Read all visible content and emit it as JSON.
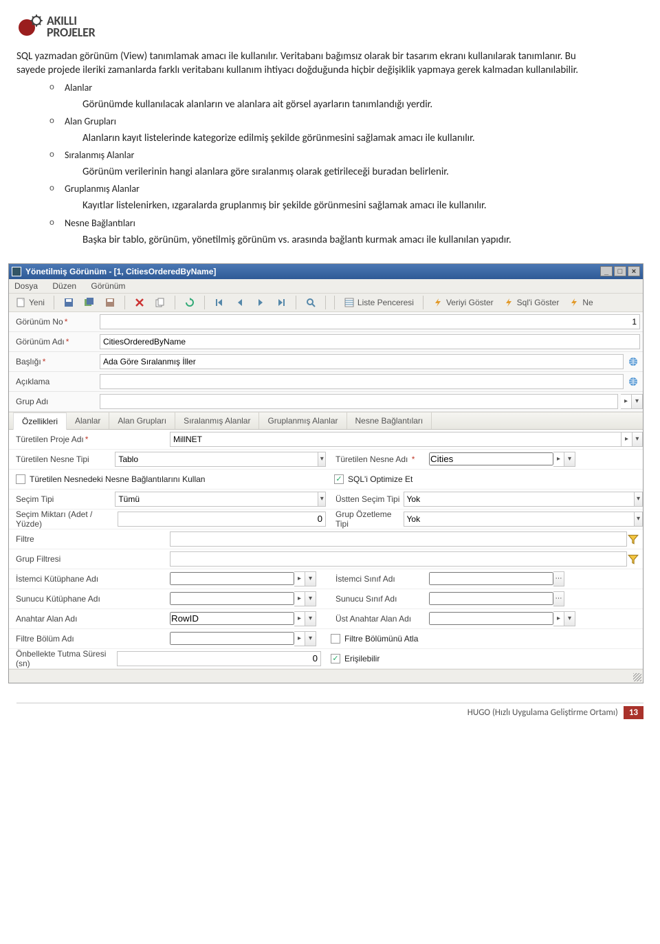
{
  "logo": {
    "line1": "AKILLI",
    "line2": "PROJELER"
  },
  "intro": {
    "p1": "SQL yazmadan görünüm (View) tanımlamak amacı ile kullanılır. Veritabanı bağımsız olarak bir tasarım ekranı kullanılarak tanımlanır. Bu sayede projede ileriki zamanlarda farklı veritabanı kullanım ihtiyacı doğduğunda hiçbir değişiklik yapmaya gerek kalmadan kullanılabilir."
  },
  "bullets": [
    {
      "label": "Alanlar",
      "desc": "Görünümde kullanılacak alanların ve alanlara ait görsel ayarların tanımlandığı yerdir."
    },
    {
      "label": "Alan Grupları",
      "desc": "Alanların kayıt listelerinde kategorize edilmiş şekilde görünmesini sağlamak amacı ile kullanılır."
    },
    {
      "label": "Sıralanmış Alanlar",
      "desc": "Görünüm verilerinin hangi alanlara göre sıralanmış olarak getirileceği buradan belirlenir."
    },
    {
      "label": "Gruplanmış Alanlar",
      "desc": "Kayıtlar listelenirken, ızgaralarda gruplanmış bir şekilde görünmesini sağlamak amacı ile kullanılır."
    },
    {
      "label": "Nesne Bağlantıları",
      "desc": "Başka bir tablo, görünüm, yönetilmiş görünüm vs. arasında bağlantı kurmak amacı ile kullanılan yapıdır."
    }
  ],
  "window": {
    "title": "Yönetilmiş Görünüm - [1, CitiesOrderedByName]",
    "menu": [
      "Dosya",
      "Düzen",
      "Görünüm"
    ],
    "toolbar": {
      "yeni": "Yeni",
      "liste": "Liste Penceresi",
      "veriyi": "Veriyi Göster",
      "sqli": "Sql'i Göster",
      "ne": "Ne"
    },
    "form": {
      "gorunum_no_lbl": "Görünüm No",
      "gorunum_no_val": "1",
      "gorunum_adi_lbl": "Görünüm Adı",
      "gorunum_adi_val": "CitiesOrderedByName",
      "basligi_lbl": "Başlığı",
      "basligi_val": "Ada Göre Sıralanmış İller",
      "aciklama_lbl": "Açıklama",
      "aciklama_val": "",
      "grup_adi_lbl": "Grup Adı",
      "grup_adi_val": ""
    },
    "tabs": [
      "Özellikleri",
      "Alanlar",
      "Alan Grupları",
      "Sıralanmış Alanlar",
      "Gruplanmış Alanlar",
      "Nesne Bağlantıları"
    ],
    "props": {
      "turetilen_proje_adi_lbl": "Türetilen Proje Adı",
      "turetilen_proje_adi_val": "MillNET",
      "turetilen_nesne_tipi_lbl": "Türetilen Nesne Tipi",
      "turetilen_nesne_tipi_val": "Tablo",
      "turetilen_nesne_adi_lbl": "Türetilen Nesne Adı",
      "turetilen_nesne_adi_val": "Cities",
      "kullan_lbl": "Türetilen Nesnedeki Nesne Bağlantılarını Kullan",
      "sql_opt_lbl": "SQL'i Optimize Et",
      "secim_tipi_lbl": "Seçim Tipi",
      "secim_tipi_val": "Tümü",
      "ustten_secim_lbl": "Üstten Seçim Tipi",
      "ustten_secim_val": "Yok",
      "secim_miktari_lbl": "Seçim Miktarı (Adet / Yüzde)",
      "secim_miktari_val": "0",
      "grup_ozet_lbl": "Grup Özetleme Tipi",
      "grup_ozet_val": "Yok",
      "filtre_lbl": "Filtre",
      "grup_filtre_lbl": "Grup Filtresi",
      "istemci_kutuphane_lbl": "İstemci Kütüphane Adı",
      "istemci_sinif_lbl": "İstemci Sınıf Adı",
      "sunucu_kutuphane_lbl": "Sunucu Kütüphane Adı",
      "sunucu_sinif_lbl": "Sunucu Sınıf Adı",
      "anahtar_alan_lbl": "Anahtar Alan Adı",
      "anahtar_alan_val": "RowID",
      "ust_anahtar_alan_lbl": "Üst Anahtar Alan Adı",
      "filtre_bolum_lbl": "Filtre Bölüm Adı",
      "filtre_bolumunu_atla_lbl": "Filtre Bölümünü Atla",
      "onbellek_lbl": "Önbellekte Tutma Süresi (sn)",
      "onbellek_val": "0",
      "erisilebilir_lbl": "Erişilebilir"
    }
  },
  "footer": {
    "text": "HUGO (Hızlı Uygulama Geliştirme Ortamı)",
    "page": "13"
  }
}
